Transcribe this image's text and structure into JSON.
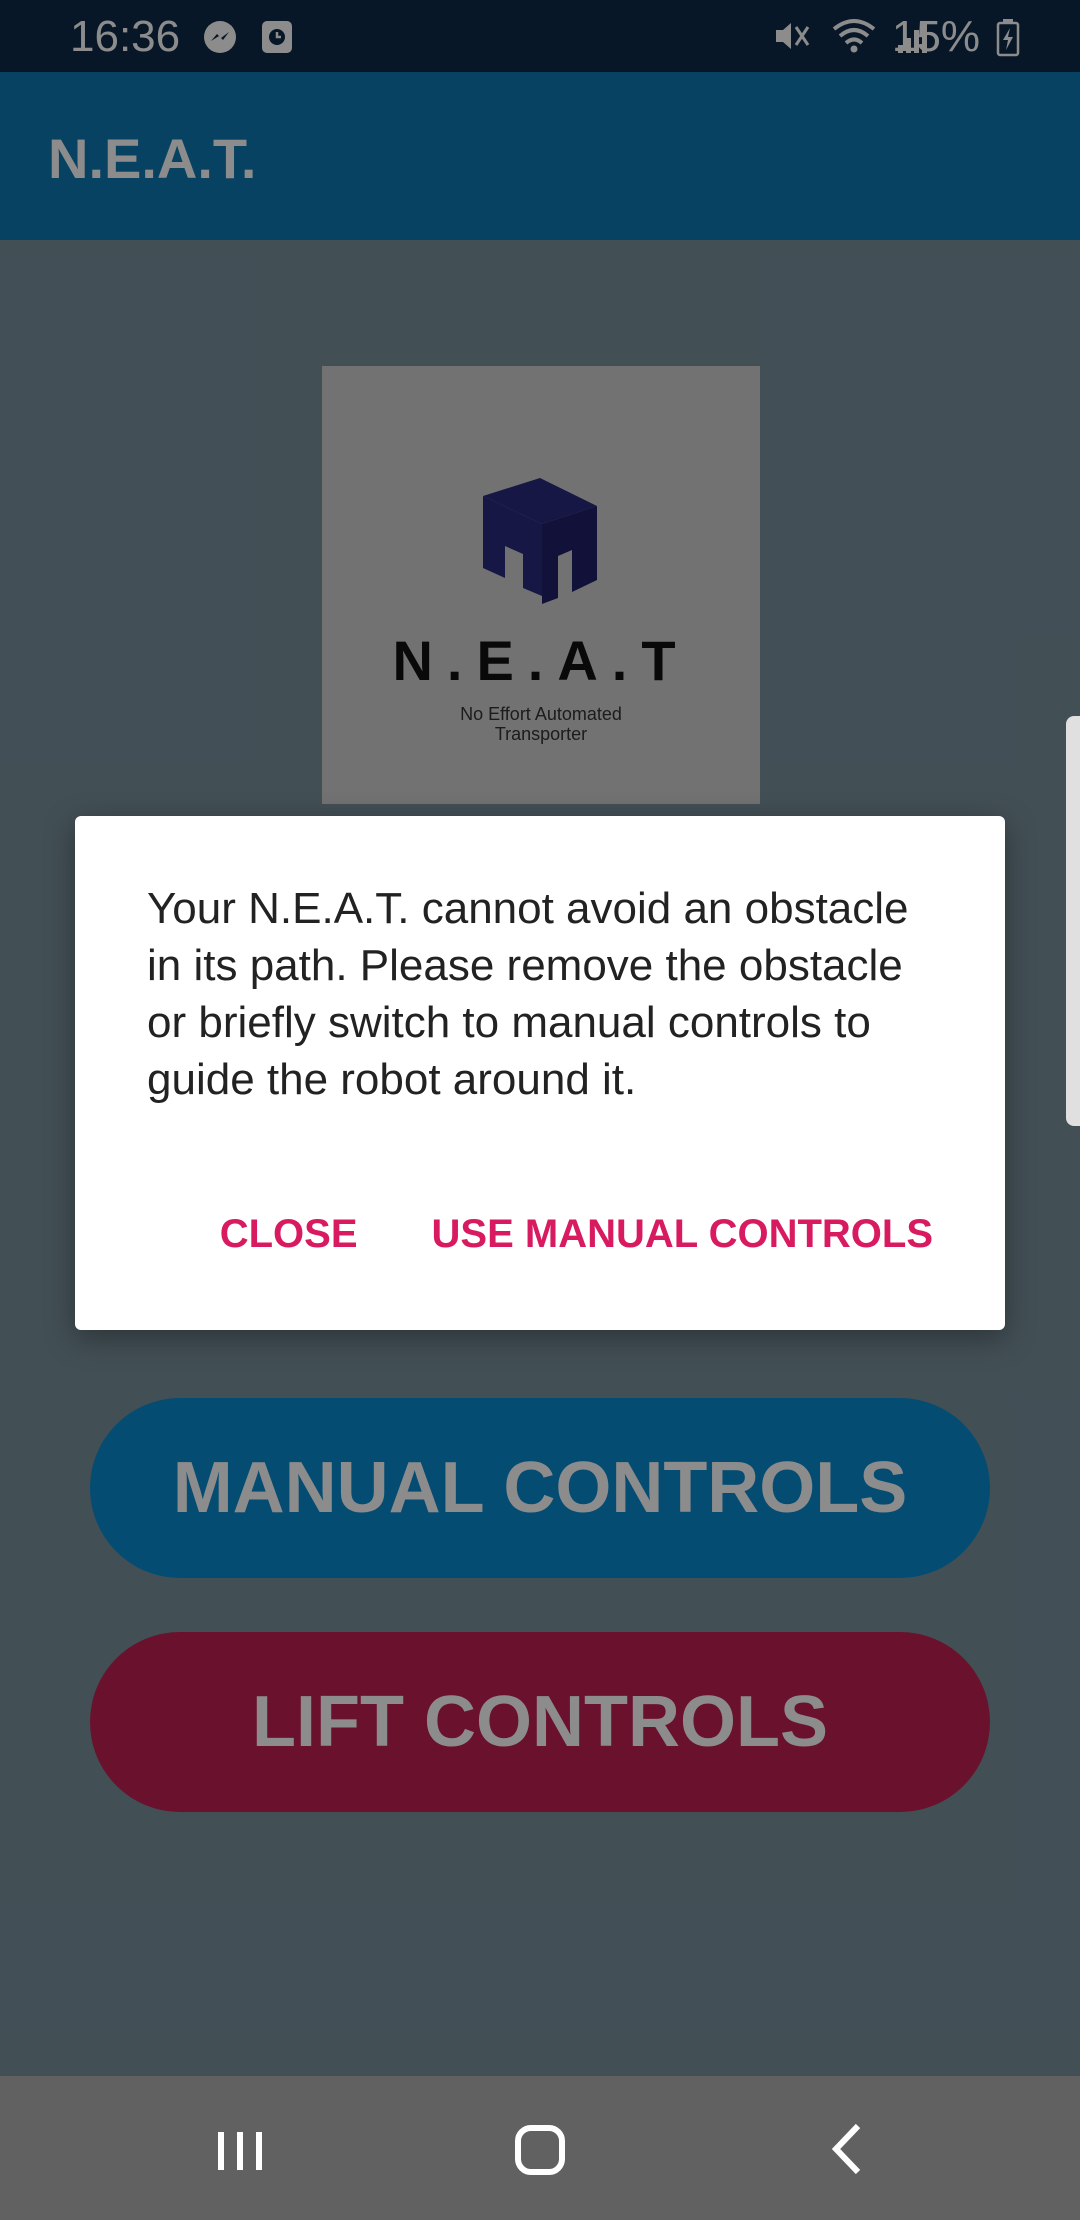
{
  "status_bar": {
    "time": "16:36",
    "battery_percent": "15%",
    "notification_icons": [
      "messenger-icon",
      "clock-app-icon"
    ],
    "system_icons": [
      "mute-icon",
      "wifi-icon",
      "signal-icon",
      "battery-charging-icon"
    ]
  },
  "app_bar": {
    "title": "N.E.A.T."
  },
  "logo": {
    "name": "N.E.A.T",
    "tagline_line1": "No Effort Automated",
    "tagline_line2": "Transporter",
    "icon": "box-robot-logo"
  },
  "buttons": {
    "manual_controls": "MANUAL CONTROLS",
    "lift_controls": "LIFT CONTROLS"
  },
  "dialog": {
    "message": "Your N.E.A.T. cannot avoid an obstacle in its path. Please remove the obstacle or briefly switch to manual controls to guide the robot around it.",
    "close_label": "CLOSE",
    "manual_label": "USE MANUAL CONTROLS"
  },
  "nav_bar": {
    "icons": [
      "recents-icon",
      "home-icon",
      "back-icon"
    ]
  },
  "colors": {
    "status_bar": "#0f2a47",
    "app_bar": "#0e79b2",
    "background": "#78909c",
    "accent": "#d81b60",
    "green_button": "#2e7d32",
    "blue_button": "#0a8ad0",
    "red_button": "#c21f52"
  }
}
